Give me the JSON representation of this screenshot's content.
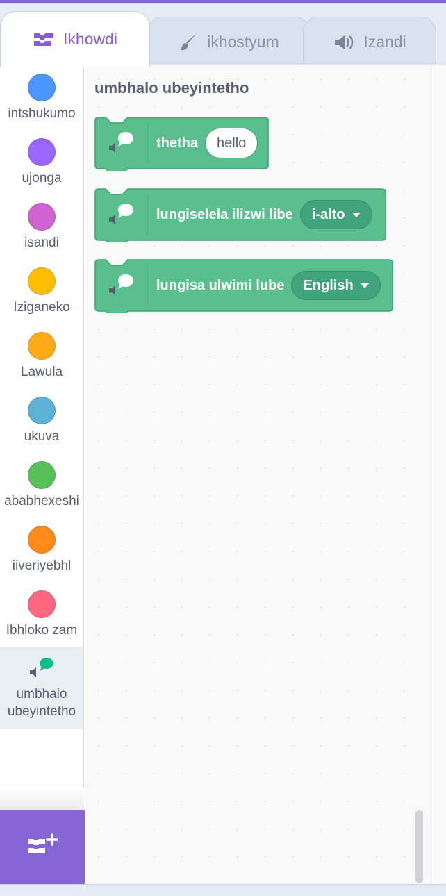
{
  "tabs": [
    {
      "label": "Ikhowdi",
      "icon": "code-icon",
      "active": true
    },
    {
      "label": "ikhostyum",
      "icon": "brush-icon",
      "active": false
    },
    {
      "label": "Izandi",
      "icon": "speaker-icon",
      "active": false
    }
  ],
  "categories": [
    {
      "label": "intshukumo",
      "color": "#4c97ff"
    },
    {
      "label": "ujonga",
      "color": "#9966ff"
    },
    {
      "label": "isandi",
      "color": "#cf63cf"
    },
    {
      "label": "Iziganeko",
      "color": "#ffbf00"
    },
    {
      "label": "Lawula",
      "color": "#ffab19"
    },
    {
      "label": "ukuva",
      "color": "#5cb1d6"
    },
    {
      "label": "ababhexeshi",
      "color": "#59c059"
    },
    {
      "label": "iiveriyebhl",
      "color": "#ff8c1a"
    },
    {
      "label": "Ibhloko zam",
      "color": "#ff6680"
    },
    {
      "label": "umbhalo ubeyintetho",
      "color": "#0fbd8c",
      "selected": true
    }
  ],
  "flyout": {
    "title": "umbhalo ubeyintetho",
    "blocks": [
      {
        "text": "thetha",
        "input": "hello"
      },
      {
        "text": "lungiselela ilizwi libe",
        "dropdown": "i-alto"
      },
      {
        "text": "lungisa ulwimi lube",
        "dropdown": "English"
      }
    ],
    "block_color": "#59c08d"
  },
  "extension_button": {
    "icon": "add-extension-icon"
  }
}
